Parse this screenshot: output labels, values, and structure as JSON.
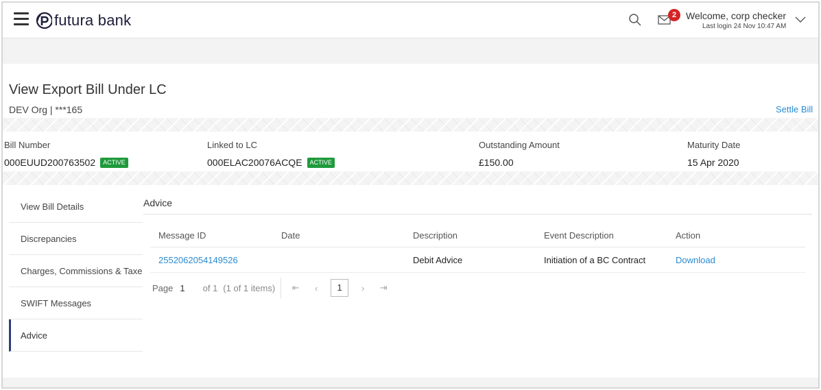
{
  "header": {
    "brand": "futura bank",
    "notification_count": "2",
    "welcome": "Welcome, corp checker",
    "last_login": "Last login 24 Nov 10:47 AM"
  },
  "page": {
    "title": "View Export Bill Under LC",
    "org": "DEV Org | ***165",
    "settle_link": "Settle Bill"
  },
  "summary": {
    "bill_number_label": "Bill Number",
    "bill_number": "000EUUD200763502",
    "bill_status": "ACTIVE",
    "linked_lc_label": "Linked to LC",
    "linked_lc": "000ELAC20076ACQE",
    "lc_status": "ACTIVE",
    "outstanding_label": "Outstanding Amount",
    "outstanding": "£150.00",
    "maturity_label": "Maturity Date",
    "maturity": "15 Apr 2020"
  },
  "sidebar": {
    "items": [
      {
        "label": "View Bill Details"
      },
      {
        "label": "Discrepancies"
      },
      {
        "label": "Charges, Commissions & Taxes"
      },
      {
        "label": "SWIFT Messages"
      },
      {
        "label": "Advice"
      }
    ]
  },
  "advice": {
    "section_title": "Advice",
    "columns": [
      "Message ID",
      "Date",
      "Description",
      "Event Description",
      "Action"
    ],
    "rows": [
      {
        "message_id": "2552062054149526",
        "date": "",
        "description": "Debit Advice",
        "event": "Initiation of a BC Contract",
        "action": "Download"
      }
    ]
  },
  "pagination": {
    "page_label": "Page",
    "page": "1",
    "of": "of 1",
    "items": "(1 of 1 items)",
    "current": "1"
  },
  "colors": {
    "accent_link": "#2a8ad0",
    "status_active": "#1f9a3b",
    "badge": "#d42424",
    "sidebar_active": "#2c3e7a"
  }
}
